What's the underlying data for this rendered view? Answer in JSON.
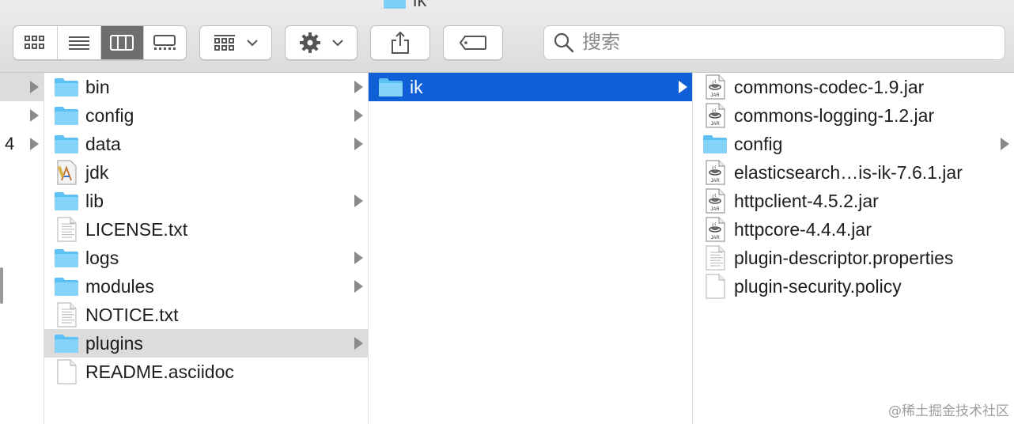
{
  "window": {
    "title": "ik"
  },
  "toolbar": {
    "view_buttons": [
      "icon-view",
      "list-view",
      "column-view",
      "gallery-view"
    ],
    "active_view": "column-view",
    "group_button": "group-by",
    "action_button": "action",
    "share_button": "share",
    "tag_button": "tags"
  },
  "search": {
    "placeholder": "搜索"
  },
  "column0": {
    "count_label": "4"
  },
  "column1": {
    "items": [
      {
        "name": "bin",
        "kind": "folder",
        "has_children": true
      },
      {
        "name": "config",
        "kind": "folder",
        "has_children": true
      },
      {
        "name": "data",
        "kind": "folder",
        "has_children": true
      },
      {
        "name": "jdk",
        "kind": "app",
        "has_children": false
      },
      {
        "name": "lib",
        "kind": "folder",
        "has_children": true
      },
      {
        "name": "LICENSE.txt",
        "kind": "text",
        "has_children": false
      },
      {
        "name": "logs",
        "kind": "folder",
        "has_children": true
      },
      {
        "name": "modules",
        "kind": "folder",
        "has_children": true
      },
      {
        "name": "NOTICE.txt",
        "kind": "text",
        "has_children": false
      },
      {
        "name": "plugins",
        "kind": "folder",
        "has_children": true,
        "selected": true
      },
      {
        "name": "README.asciidoc",
        "kind": "doc",
        "has_children": false
      }
    ]
  },
  "column2": {
    "items": [
      {
        "name": "ik",
        "kind": "folder",
        "has_children": true,
        "selected": true
      }
    ]
  },
  "column3": {
    "items": [
      {
        "name": "commons-codec-1.9.jar",
        "kind": "jar",
        "has_children": false
      },
      {
        "name": "commons-logging-1.2.jar",
        "kind": "jar",
        "has_children": false
      },
      {
        "name": "config",
        "kind": "folder",
        "has_children": true
      },
      {
        "name": "elasticsearch…is-ik-7.6.1.jar",
        "kind": "jar",
        "has_children": false
      },
      {
        "name": "httpclient-4.5.2.jar",
        "kind": "jar",
        "has_children": false
      },
      {
        "name": "httpcore-4.4.4.jar",
        "kind": "jar",
        "has_children": false
      },
      {
        "name": "plugin-descriptor.properties",
        "kind": "text",
        "has_children": false
      },
      {
        "name": "plugin-security.policy",
        "kind": "doc",
        "has_children": false
      }
    ]
  },
  "watermark": "@稀土掘金技术社区",
  "colors": {
    "selection_blue": "#0f5fd7",
    "selection_gray": "#dcdcdc",
    "folder_blue": "#5cc0f5"
  }
}
